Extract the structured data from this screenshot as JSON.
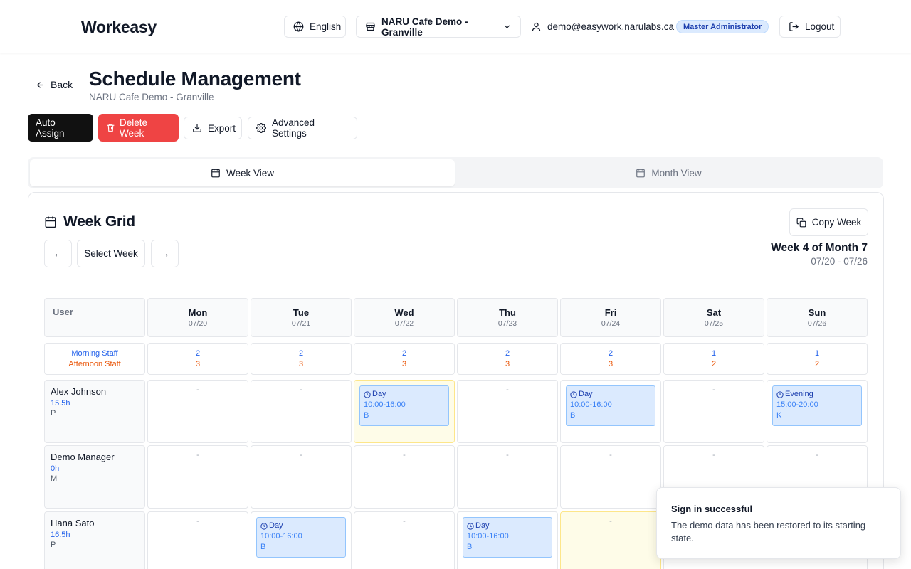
{
  "header": {
    "brand": "Workeasy",
    "language": "English",
    "store": "NARU Cafe Demo - Granville",
    "email": "demo@easywork.narulabs.ca",
    "role": "Master Administrator",
    "logout": "Logout"
  },
  "page": {
    "back": "Back",
    "title": "Schedule Management",
    "subtitle": "NARU Cafe Demo - Granville"
  },
  "actions": {
    "auto_assign": "Auto Assign",
    "delete_week": "Delete Week",
    "export": "Export",
    "advanced": "Advanced Settings"
  },
  "tabs": {
    "week": "Week View",
    "month": "Month View"
  },
  "grid": {
    "title": "Week Grid",
    "prev": "←",
    "select_week": "Select Week",
    "next": "→",
    "copy_week": "Copy Week",
    "week_label": "Week 4 of Month 7",
    "week_range": "07/20 - 07/26",
    "user_col": "User",
    "morning_label": "Morning Staff",
    "afternoon_label": "Afternoon Staff",
    "empty": "-",
    "days": [
      {
        "name": "Mon",
        "date": "07/20",
        "morning": "2",
        "afternoon": "3"
      },
      {
        "name": "Tue",
        "date": "07/21",
        "morning": "2",
        "afternoon": "3"
      },
      {
        "name": "Wed",
        "date": "07/22",
        "morning": "2",
        "afternoon": "3"
      },
      {
        "name": "Thu",
        "date": "07/23",
        "morning": "2",
        "afternoon": "3"
      },
      {
        "name": "Fri",
        "date": "07/24",
        "morning": "2",
        "afternoon": "3"
      },
      {
        "name": "Sat",
        "date": "07/25",
        "morning": "1",
        "afternoon": "2"
      },
      {
        "name": "Sun",
        "date": "07/26",
        "morning": "1",
        "afternoon": "2"
      }
    ],
    "users": [
      {
        "name": "Alex Johnson",
        "hours": "15.5h",
        "code": "P",
        "shifts": [
          null,
          null,
          {
            "type": "Day",
            "time": "10:00-16:00",
            "code": "B"
          },
          null,
          {
            "type": "Day",
            "time": "10:00-16:00",
            "code": "B"
          },
          null,
          {
            "type": "Evening",
            "time": "15:00-20:00",
            "code": "K"
          }
        ],
        "highlight": [
          false,
          false,
          true,
          false,
          false,
          false,
          false
        ]
      },
      {
        "name": "Demo Manager",
        "hours": "0h",
        "code": "M",
        "shifts": [
          null,
          null,
          null,
          null,
          null,
          null,
          null
        ],
        "highlight": [
          false,
          false,
          false,
          false,
          false,
          false,
          false
        ]
      },
      {
        "name": "Hana Sato",
        "hours": "16.5h",
        "code": "P",
        "shifts": [
          null,
          {
            "type": "Day",
            "time": "10:00-16:00",
            "code": "B"
          },
          null,
          {
            "type": "Day",
            "time": "10:00-16:00",
            "code": "B"
          },
          null,
          null,
          null
        ],
        "highlight": [
          false,
          false,
          false,
          false,
          true,
          false,
          false
        ]
      }
    ]
  },
  "toast": {
    "title": "Sign in successful",
    "description": "The demo data has been restored to its starting state."
  }
}
